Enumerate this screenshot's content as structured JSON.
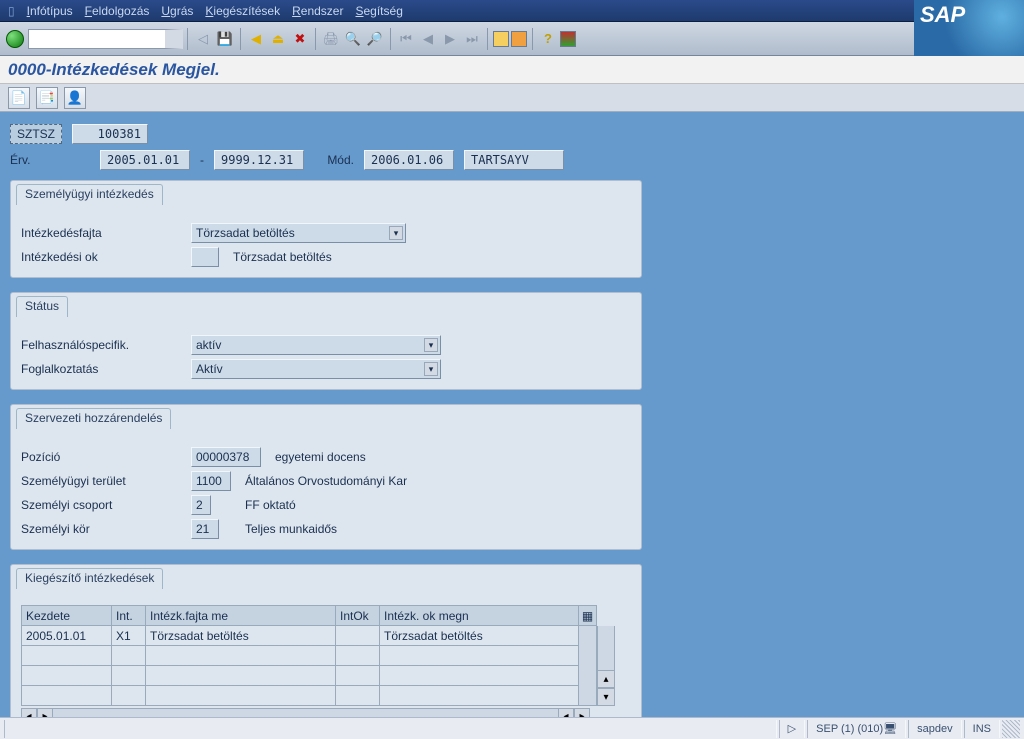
{
  "menu": {
    "items": [
      "Infótípus",
      "Feldolgozás",
      "Ugrás",
      "Kiegészítések",
      "Rendszer",
      "Segítség"
    ]
  },
  "page_title": "0000-Intézkedések Megjel.",
  "header": {
    "sztsz_label": "SZTSZ",
    "sztsz_value": "100381",
    "erv_label": "Érv.",
    "erv_from": "2005.01.01",
    "erv_sep": "-",
    "erv_to": "9999.12.31",
    "mod_label": "Mód.",
    "mod_date": "2006.01.06",
    "mod_user": "TARTSAYV"
  },
  "group_action": {
    "title": "Személyügyi intézkedés",
    "type_label": "Intézkedésfajta",
    "type_value": "Törzsadat betöltés",
    "reason_label": "Intézkedési ok",
    "reason_code": "",
    "reason_text": "Törzsadat betöltés"
  },
  "group_status": {
    "title": "Státus",
    "userspec_label": "Felhasználóspecifik.",
    "userspec_value": "aktív",
    "employment_label": "Foglalkoztatás",
    "employment_value": "Aktív"
  },
  "group_org": {
    "title": "Szervezeti hozzárendelés",
    "position_label": "Pozíció",
    "position_code": "00000378",
    "position_text": "egyetemi docens",
    "area_label": "Személyügyi terület",
    "area_code": "1100",
    "area_text": "Általános Orvostudományi Kar",
    "group_label": "Személyi csoport",
    "group_code": "2",
    "group_text": "FF oktató",
    "subgroup_label": "Személyi kör",
    "subgroup_code": "21",
    "subgroup_text": "Teljes munkaidős"
  },
  "group_add": {
    "title": "Kiegészítő intézkedések",
    "cols": {
      "c0": "Kezdete",
      "c1": "Int.",
      "c2": "Intézk.fajta me",
      "c3": "IntOk",
      "c4": "Intézk. ok megn"
    },
    "rows": [
      {
        "c0": "2005.01.01",
        "c1": "X1",
        "c2": "Törzsadat betöltés",
        "c3": "",
        "c4": "Törzsadat betöltés"
      }
    ]
  },
  "status": {
    "session": "SEP (1) (010)",
    "server": "sapdev",
    "mode": "INS"
  },
  "brand": "SAP"
}
